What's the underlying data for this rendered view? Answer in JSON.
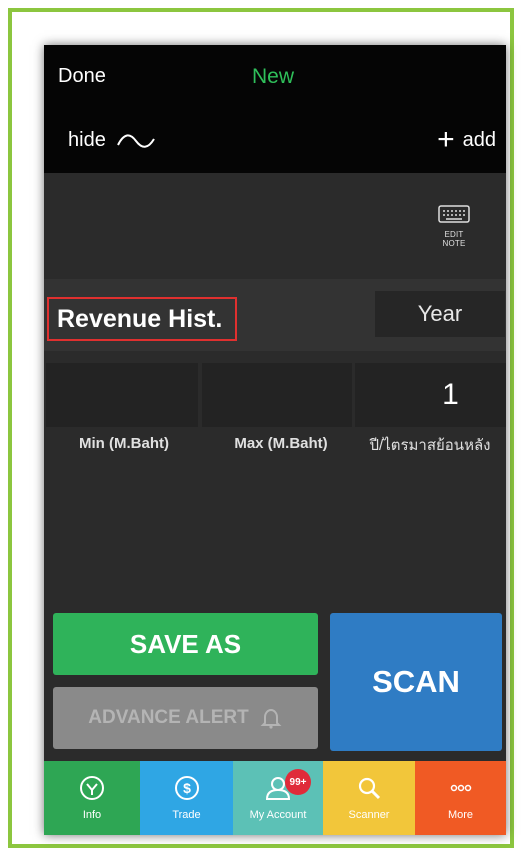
{
  "nav": {
    "done": "Done",
    "title": "New",
    "hide": "hide",
    "add": "add"
  },
  "edit_note": {
    "label": "EDIT NOTE"
  },
  "criteria": {
    "title": "Revenue Hist.",
    "period_header": "Year",
    "min_value": "",
    "max_value": "",
    "year_value": "1",
    "min_label": "Min (M.Baht)",
    "max_label": "Max (M.Baht)",
    "year_label": "ปี/ไตรมาสย้อนหลัง"
  },
  "actions": {
    "save_as": "SAVE AS",
    "advance_alert": "ADVANCE ALERT",
    "scan": "SCAN"
  },
  "tabbar": {
    "items": [
      {
        "label": "Info",
        "icon": "info-icon"
      },
      {
        "label": "Trade",
        "icon": "dollar-icon"
      },
      {
        "label": "My Account",
        "icon": "user-icon",
        "badge": "99+"
      },
      {
        "label": "Scanner",
        "icon": "magnifier-icon"
      },
      {
        "label": "More",
        "icon": "more-icon"
      }
    ]
  },
  "colors": {
    "accent_green": "#2fb35a",
    "scan_blue": "#2f7cc4",
    "highlight_red": "#e0302f",
    "frame_green": "#8cc63f"
  }
}
